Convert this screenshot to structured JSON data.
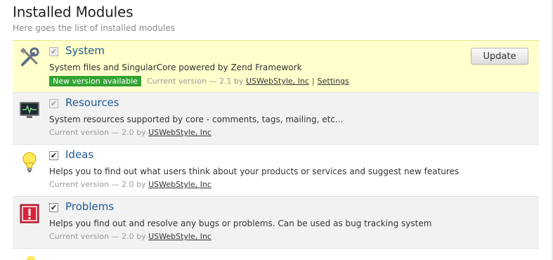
{
  "header": {
    "title": "Installed Modules",
    "subtitle": "Here goes the list of installed modules"
  },
  "modules": [
    {
      "name": "System",
      "description": "System files and SingularCore powered by Zend Framework",
      "badge": "New version available",
      "version_text": "Current version — 2.1 by",
      "author": "USWebStyle, Inc",
      "separator": "|",
      "settings_label": "Settings",
      "update_label": "Update",
      "checked": true,
      "locked": true,
      "icon": "tools-icon"
    },
    {
      "name": "Resources",
      "description": "System resources supported by core - comments, tags, mailing, etc...",
      "version_text": "Current version — 2.0 by",
      "author": "USWebStyle, Inc",
      "checked": true,
      "locked": true,
      "icon": "monitor-icon"
    },
    {
      "name": "Ideas",
      "description": "Helps you to find out what users think about your products or services and suggest new features",
      "version_text": "Current version — 2.0 by",
      "author": "USWebStyle, Inc",
      "checked": true,
      "locked": false,
      "icon": "lightbulb-icon"
    },
    {
      "name": "Problems",
      "description": "Helps you find out and resolve any bugs or problems. Can be used as bug tracking system",
      "version_text": "Current version — 2.0 by",
      "author": "USWebStyle, Inc",
      "checked": true,
      "locked": false,
      "icon": "warning-icon"
    }
  ],
  "colors": {
    "highlight_bg": "#ffffcc",
    "badge_green": "#33a333",
    "link_blue": "#1f5a93"
  }
}
